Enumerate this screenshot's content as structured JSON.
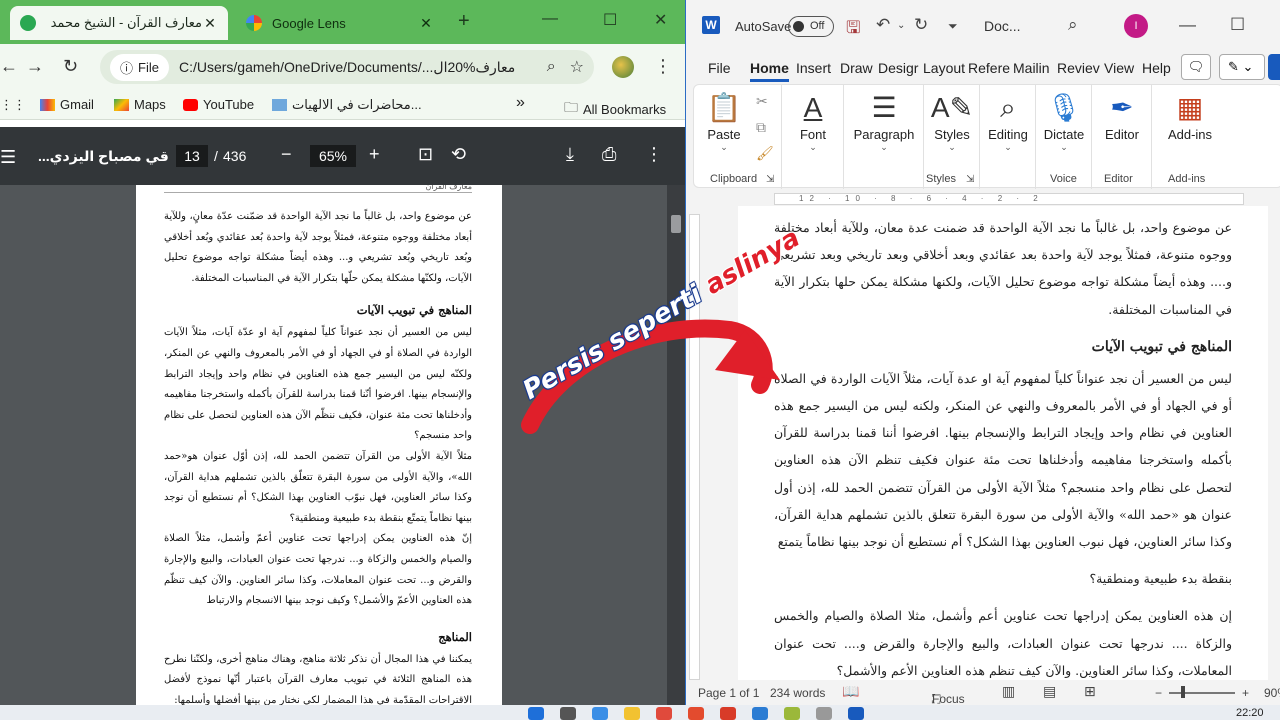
{
  "browser": {
    "tabs": [
      {
        "label": "معارف القرآن - الشيخ محمد",
        "favicon_color": "#2aa852"
      },
      {
        "label": "Google Lens",
        "favicon_color": "#4285f4"
      }
    ],
    "address": {
      "chip": "File",
      "url": "C:/Users/gameh/OneDrive/Documents/...معارف%20ال"
    },
    "bookmarks": [
      {
        "label": "Gmail",
        "icon": "gmail-icon"
      },
      {
        "label": "Maps",
        "icon": "maps-icon"
      },
      {
        "label": "YouTube",
        "icon": "youtube-icon"
      },
      {
        "label": "محاضرات في الالهيات...",
        "icon": "page-icon"
      }
    ],
    "all_bookmarks": "All Bookmarks",
    "more": "»"
  },
  "pdf": {
    "title": "...قي مصباح اليزدي",
    "page_current": "13",
    "page_separator": "/",
    "page_total": "436",
    "zoom": "65%",
    "running_head": "معارف القرآن",
    "paragraphs": [
      "عن موضوع واحد، بل غالباً ما نجد الآية الواحدة قد ضمّنت عدّة معانٍ، وللآية أبعاد مختلفة ووجوه متنوعة، فمثلاً يوجد لآية واحدة بُعد عقائدي وبُعد أخلاقي وبُعد تاريخي وبُعد تشريعي و... وهذه أيضاً مشكلة تواجه موضوع تحليل الآيات، ولكنّها مشكلة يمكن حلّها بتكرار الآية في المناسبات المختلفة."
    ],
    "heading1": "المناهج في تبويب الآيات",
    "para2": "ليس من العسير أن نجد عنواناً كلياً لمفهوم آية او عدّة آيات، مثلاً الآيات الواردة في الصلاة أو في الجهاد أو في الأمر بالمعروف والنهي عن المنكر، ولكنّه ليس من اليسير جمع هذه العناوين في نظام واحد وإيجاد الترابط والإنسجام بينها. افرضوا أنّنا قمنا بدراسة للقرآن بأكمله واستخرجنا مفاهيمه وأدخلناها تحت مئة عنوان، فكيف ننظّم الآن هذه العناوين لنحصل على نظام واحد منسجم؟",
    "para3": "مثلاً الآية الأولى من القرآن تتضمن الحمد لله، إذن أوّل عنوان هو«حمد الله»، والآية الأولى من سورة البقرة تتعلّق بالذين تشملهم هداية القرآن، وكذا سائر العناوين، فهل نبوّب العناوين بهذا الشكل؟ أم نستطيع أن نوجد بينها نظاماً يتمتّع بنقطة بدء طبيعية ومنطقية؟",
    "para4": "إنّ هذه العناوين يمكن إدراجها تحت عناوين أعمّ وأشمل، مثلاً الصلاة والصيام والخمس والزكاة و... ندرجها تحت عنوان العبادات، والبيع والإجارة والقرض و... تحت عنوان المعاملات، وكذا سائر العناوين. والآن كيف تنظّم هذه العناوين الأعمّ والأشمل؟ وكيف نوجد بينها الانسجام والارتباط",
    "heading2": "المناهج",
    "para5": "يمكننا في هذا المجال أن نذكر ثلاثة مناهج، وهناك مناهج أخرى، ولكنّنا نطرح هذه المناهج الثلاثة في تبويب معارف القرآن باعتبار أنّها نموذج لأفضل الاقتراحات المقدّمة في هذا المضمار لكي نختار من بينها أفضلها وأسلمها:"
  },
  "word": {
    "autosave": "AutoSave",
    "toggle": "Off",
    "doc": "Doc...",
    "avatar": "I",
    "menu": [
      "File",
      "Home",
      "Insert",
      "Draw",
      "Design",
      "Layout",
      "References",
      "Mailings",
      "Review",
      "View",
      "Help"
    ],
    "menu_display": [
      "File",
      "Home",
      "Insert",
      "Draw",
      "Desigr",
      "Layout",
      "Refere",
      "Mailin",
      "Reviev",
      "View",
      "Help"
    ],
    "ribbon": {
      "paste": "Paste",
      "clipboard": "Clipboard",
      "font": "Font",
      "paragraph": "Paragraph",
      "styles": "Styles",
      "styles_group": "Styles",
      "editing": "Editing",
      "dictate": "Dictate",
      "voice": "Voice",
      "editor": "Editor",
      "editor_group": "Editor",
      "addins": "Add-ins",
      "addins_group": "Add-ins"
    },
    "ruler_marks": "12 · 10 · 8 · 6 · 4 · 2 · 2",
    "page": {
      "p1": "عن موضوع واحد، بل غالباً ما نجد الآية الواحدة قد ضمنت عدة معان، وللآية أبعاد مختلفة ووجوه متنوعة، فمثلاً يوجد لآية واحدة بعد عقائدي وبعد أخلاقي وبعد تاريخي وبعد تشريعي و.... وهذه أيضاً مشكلة تواجه موضوع تحليل الآيات، ولكنها مشكلة يمكن حلها بتكرار الآية في المناسبات المختلفة.",
      "h1": "المناهج في تبويب الآيات",
      "p2": "ليس من العسير أن نجد عنواناً كلياً لمفهوم آية او عدة آيات، مثلاً الآيات الواردة في الصلاة أو في الجهاد أو في الأمر بالمعروف والنهي عن المنكر، ولكنه ليس من اليسير جمع هذه العناوين في نظام واحد وإيجاد الترابط والإنسجام بينها. افرضوا أننا قمنا بدراسة للقرآن بأكمله واستخرجنا مفاهيمه وأدخلناها تحت مئة عنوان فكيف تنظم الآن هذه العناوين لتحصل على نظام واحد منسجم؟ مثلاً الآية الأولى من القرآن تتضمن الحمد لله، إذن أول عنوان هو «حمد الله» والآية الأولى من سورة البقرة تتعلق بالذين تشملهم هداية القرآن، وكذا سائر العناوين، فهل نبوب العناوين بهذا الشكل؟ أم نستطيع أن نوجد بينها نظاماً يتمتع",
      "p3": "بنقطة بدء طبيعية ومنطقية؟",
      "p4": "إن هذه العناوين يمكن إدراجها تحت عناوين أعم وأشمل، مثلا الصلاة والصيام والخمس والزكاة .... ندرجها تحت عنوان العبادات، والبيع والإجارة والقرض و.... تحت عنوان المعاملات، وكذا سائر العناوين. والآن كيف تنظم هذه العناوين الأعم والأشمل؟"
    },
    "status": {
      "page": "Page 1 of 1",
      "words": "234 words",
      "focus": "Focus",
      "zoom": "90%"
    }
  },
  "overlay": {
    "caption_main": "Persis seperti ",
    "caption_accent": "aslinya",
    "arrow_color": "#e01f2a"
  },
  "taskbar": {
    "time": "22:20"
  }
}
